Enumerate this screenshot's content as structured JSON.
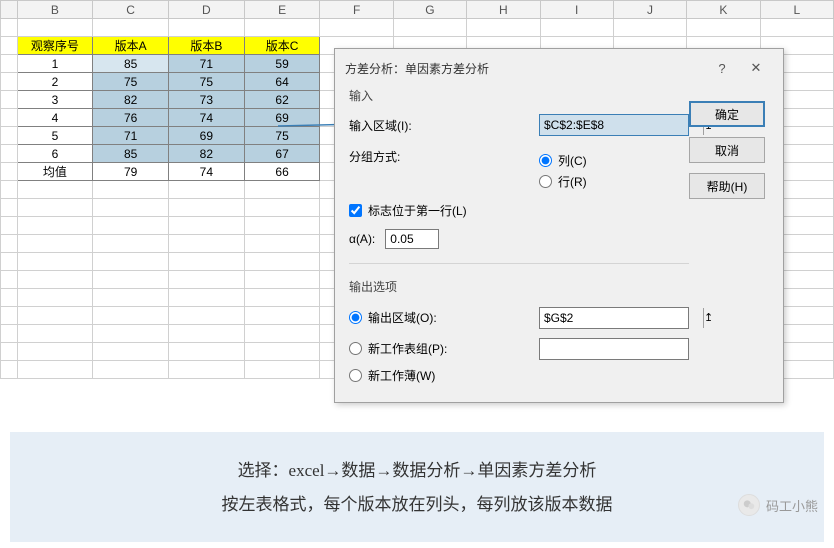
{
  "columns": [
    "B",
    "C",
    "D",
    "E",
    "F",
    "G",
    "H",
    "I",
    "J",
    "K",
    "L"
  ],
  "table": {
    "headers": [
      "观察序号",
      "版本A",
      "版本B",
      "版本C"
    ],
    "rows": [
      {
        "label": "1",
        "a": "85",
        "b": "71",
        "c": "59"
      },
      {
        "label": "2",
        "a": "75",
        "b": "75",
        "c": "64"
      },
      {
        "label": "3",
        "a": "82",
        "b": "73",
        "c": "62"
      },
      {
        "label": "4",
        "a": "76",
        "b": "74",
        "c": "69"
      },
      {
        "label": "5",
        "a": "71",
        "b": "69",
        "c": "75"
      },
      {
        "label": "6",
        "a": "85",
        "b": "82",
        "c": "67"
      }
    ],
    "mean_label": "均值",
    "means": [
      "79",
      "74",
      "66"
    ]
  },
  "dialog": {
    "title": "方差分析：单因素方差分析",
    "help_symbol": "?",
    "close_symbol": "✕",
    "input_group": "输入",
    "input_range_label": "输入区域(I):",
    "input_range_value": "$C$2:$E$8",
    "picker_glyph": "↥",
    "group_by_label": "分组方式:",
    "radio_col": "列(C)",
    "radio_row": "行(R)",
    "labels_first_row": "标志位于第一行(L)",
    "alpha_label": "α(A):",
    "alpha_value": "0.05",
    "output_group": "输出选项",
    "output_range_label": "输出区域(O):",
    "output_range_value": "$G$2",
    "new_sheet_label": "新工作表组(P):",
    "new_book_label": "新工作薄(W)",
    "ok": "确定",
    "cancel": "取消",
    "help": "帮助(H)"
  },
  "caption": {
    "line1": "选择：excel→数据→数据分析→单因素方差分析",
    "line2": "按左表格式，每个版本放在列头，每列放该版本数据"
  },
  "watermark": "码工小熊"
}
